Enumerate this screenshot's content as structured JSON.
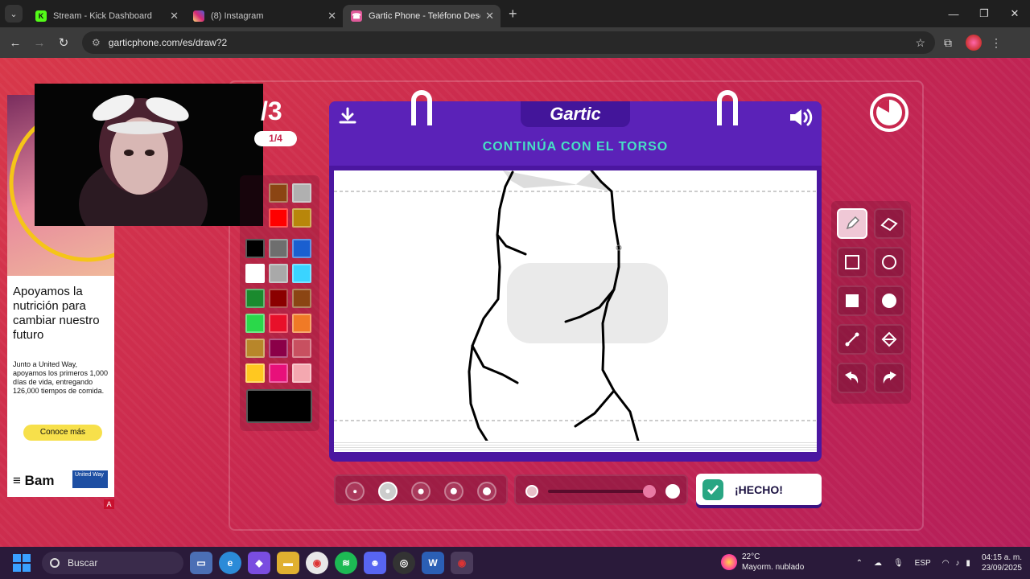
{
  "browser": {
    "tabs": [
      {
        "title": "Stream - Kick Dashboard",
        "icon": "kick-icon",
        "color": "#53fc18"
      },
      {
        "title": "(8) Instagram",
        "icon": "instagram-icon",
        "color": "#e1306c"
      },
      {
        "title": "Gartic Phone - Teléfono Descon",
        "icon": "gartic-icon",
        "color": "#e05a9a",
        "active": true
      }
    ],
    "url": "garticphone.com/es/draw?2"
  },
  "ad": {
    "headline": "Apoyamos la nutrición para cambiar nuestro futuro",
    "body": "Junto a United Way, apoyamos los primeros 1,000 días de vida, entregando 126,000 tiempos de comida.",
    "cta": "Conoce más",
    "brand": "Bam",
    "partner": "United Way",
    "badge": "A"
  },
  "game": {
    "round": "/3",
    "subround": "1/4",
    "logo": "Gartic",
    "prompt": "CONTINÚA CON EL TORSO",
    "done_label": "¡HECHO!",
    "palette": [
      "#8b4513",
      "#b0b0b0",
      "#ff0000",
      "#b8860b",
      "#000000",
      "#6e6e6e",
      "#1a5fd0",
      "#ffffff",
      "#a9a9a9",
      "#3ad4ff",
      "#1a8a2e",
      "#8b0000",
      "#8b4513",
      "#2ad84a",
      "#e8102a",
      "#f07a26",
      "#b8862a",
      "#8b0048",
      "#c85060",
      "#ffc820",
      "#e8107a",
      "#f4a8b0"
    ],
    "selected_color": "#000000",
    "brush_sizes": [
      1,
      2,
      3,
      4,
      5
    ],
    "selected_brush_index": 1,
    "opacity": 0.9,
    "tools": [
      "pencil-icon",
      "eraser-icon",
      "rectangle-outline-icon",
      "circle-outline-icon",
      "rectangle-fill-icon",
      "circle-fill-icon",
      "line-icon",
      "fill-bucket-icon",
      "undo-icon",
      "redo-icon"
    ],
    "active_tool": "pencil-icon"
  },
  "taskbar": {
    "search_placeholder": "Buscar",
    "weather_temp": "22°C",
    "weather_desc": "Mayorm. nublado",
    "lang": "ESP",
    "time": "04:15 a. m.",
    "date": "23/09/2025"
  }
}
